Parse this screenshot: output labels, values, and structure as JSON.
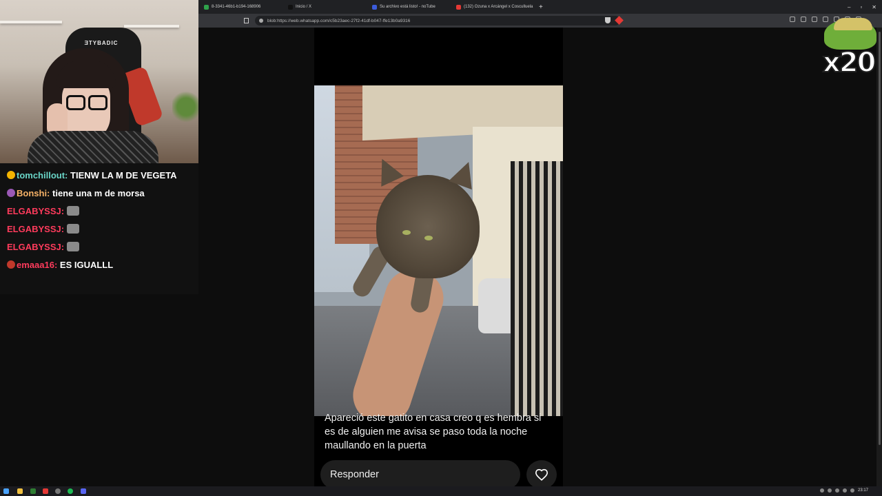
{
  "browser": {
    "tabs": [
      {
        "label": "8-3341-46b1-b194-168906",
        "favicon_color": "#2fa24b"
      },
      {
        "label": "Inicio / X",
        "favicon_color": "#111111"
      },
      {
        "label": "Su archivo está listo! - noTube",
        "favicon_color": "#3b5bdb"
      },
      {
        "label": "(132) Ozuna x Arcángel x Cosculluela",
        "favicon_color": "#e53935"
      }
    ],
    "new_tab_label": "+",
    "url": "blob:https://web.whatsapp.com/c5b23aec-27f2-41df-b047-ffe13b0a9316",
    "window_controls": [
      "–",
      "▫",
      "✕"
    ]
  },
  "chat": {
    "messages": [
      {
        "user": "tomchillout:",
        "user_color": "#6ad6c8",
        "text": "TIENW LA M DE VEGETA",
        "emote": false,
        "badge_color": "#f4b400"
      },
      {
        "user": "Bonshi:",
        "user_color": "#f7b267",
        "text": "tiene una m de morsa",
        "emote": false,
        "badge_color": "#9b59b6"
      },
      {
        "user": "ELGABYSSJ:",
        "user_color": "#ff3b5c",
        "text": "",
        "emote": true,
        "badge_color": ""
      },
      {
        "user": "ELGABYSSJ:",
        "user_color": "#ff3b5c",
        "text": "",
        "emote": true,
        "badge_color": ""
      },
      {
        "user": "ELGABYSSJ:",
        "user_color": "#ff3b5c",
        "text": "",
        "emote": true,
        "badge_color": ""
      },
      {
        "user": "emaaa16:",
        "user_color": "#ff3b5c",
        "text": "ES IGUALLL",
        "emote": false,
        "badge_color": "#c0392b"
      }
    ]
  },
  "webcam": {
    "chair_brand": "ƎTYBADIC"
  },
  "status": {
    "caption": "Apareció este gatito en casa creo q es hembra si es de alguien me avisa se paso toda la noche maullando en la puerta",
    "reply_placeholder": "Responder",
    "like_icon": "heart-icon"
  },
  "overlay": {
    "multiplier": "x20"
  },
  "taskbar": {
    "clock": "23:17"
  }
}
